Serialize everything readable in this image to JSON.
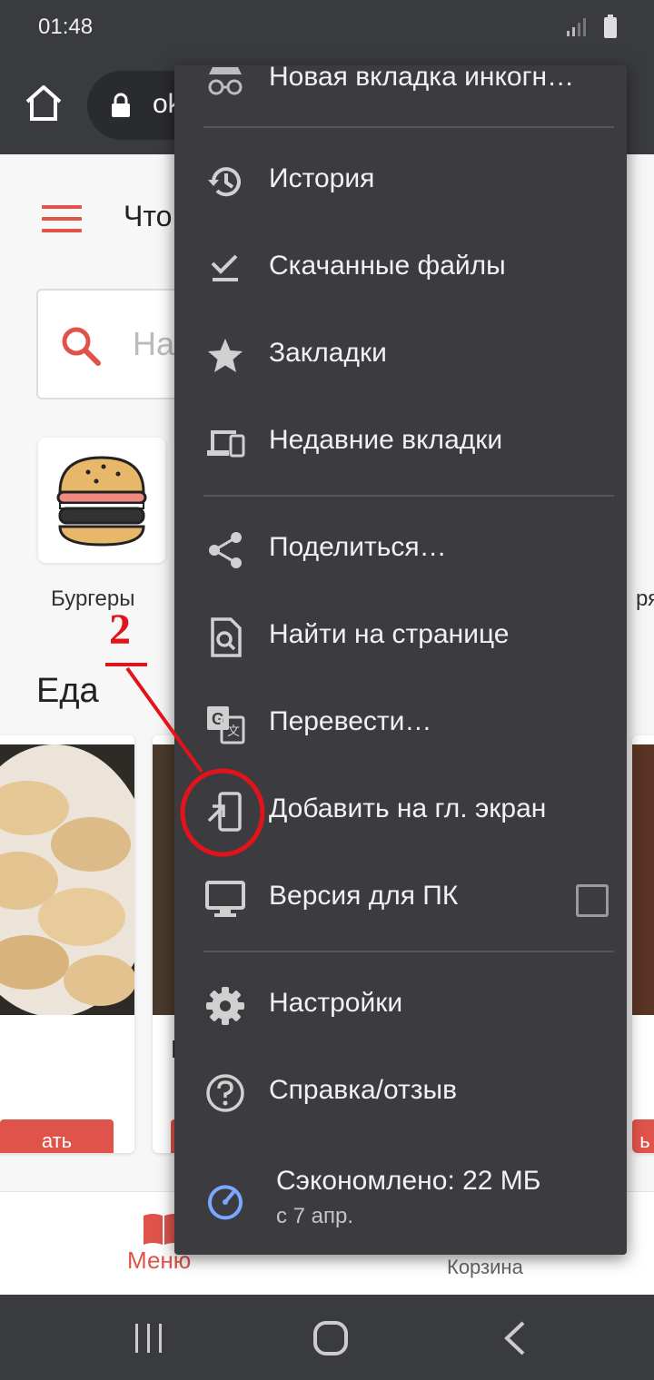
{
  "status_bar": {
    "time": "01:48"
  },
  "browser": {
    "url_fragment": "ok"
  },
  "page": {
    "title_fragment": "Что",
    "search_placeholder_fragment": "На",
    "category": {
      "label": "Бургеры",
      "label_edge": "ря"
    },
    "section_title": "Еда",
    "card_title_fragment": "П",
    "order_button_fragment": "ать",
    "order_button_edge": "ь"
  },
  "bottom_nav": {
    "menu_label": "Меню",
    "cart_label": "Корзина"
  },
  "menu": {
    "items": [
      {
        "label": "Новая вкладка инкогн…",
        "icon": "incognito-icon"
      },
      {
        "label": "История",
        "icon": "history-icon"
      },
      {
        "label": "Скачанные файлы",
        "icon": "download-check-icon"
      },
      {
        "label": "Закладки",
        "icon": "star-icon"
      },
      {
        "label": "Недавние вкладки",
        "icon": "devices-icon"
      },
      {
        "label": "Поделиться…",
        "icon": "share-icon"
      },
      {
        "label": "Найти на странице",
        "icon": "find-page-icon"
      },
      {
        "label": "Перевести…",
        "icon": "translate-icon"
      },
      {
        "label": "Добавить на гл. экран",
        "icon": "add-to-home-icon"
      },
      {
        "label": "Версия для ПК",
        "icon": "desktop-icon",
        "checked": false
      },
      {
        "label": "Настройки",
        "icon": "gear-icon"
      },
      {
        "label": "Справка/отзыв",
        "icon": "help-icon"
      }
    ],
    "data_saver": {
      "title": "Сэкономлено: 22 МБ",
      "subtitle": "с 7 апр."
    }
  },
  "annotation": {
    "step_number": "2"
  },
  "colors": {
    "accent": "#e0534b",
    "menu_bg": "#3c3c40",
    "toolbar": "#3a3b3f",
    "annotation": "#e3131b",
    "saver_icon": "#7aa7ff"
  }
}
